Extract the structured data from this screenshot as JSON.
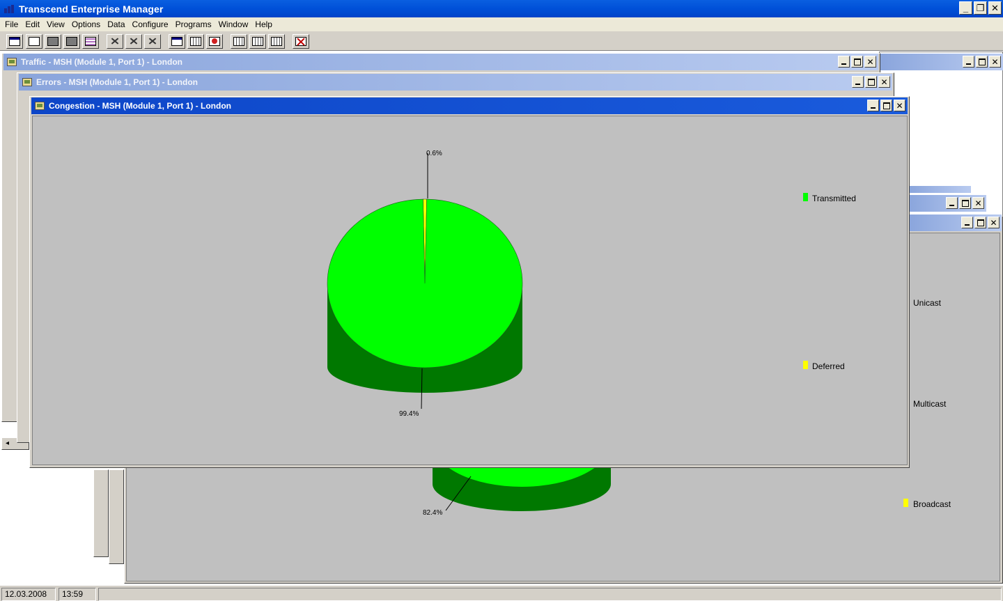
{
  "app": {
    "title": "Transcend Enterprise Manager",
    "controls": {
      "minimize": "_",
      "restore": "❐",
      "close": "✕"
    }
  },
  "menu": [
    "File",
    "Edit",
    "View",
    "Options",
    "Data",
    "Configure",
    "Programs",
    "Window",
    "Help"
  ],
  "toolbar": {
    "buttons": [
      "window-icon",
      "copy-icon",
      "export-icon",
      "add-node-icon",
      "print-icon",
      "tools-icon",
      "tools-x-icon",
      "tools-check-icon",
      "link-icon",
      "grid-icon",
      "alarm-icon",
      "table-icon",
      "table2-icon",
      "keyboard-icon",
      "stop-icon"
    ]
  },
  "windows": {
    "traffic": {
      "title": "Traffic - MSH (Module 1, Port 1) - London"
    },
    "errors": {
      "title": "Errors - MSH (Module 1, Port 1) - London"
    },
    "congestion": {
      "title": "Congestion - MSH (Module 1, Port 1) - London"
    }
  },
  "chart_data": [
    {
      "type": "pie",
      "window": "Congestion - MSH (Module 1, Port 1) - London",
      "categories": [
        "Transmitted",
        "Deferred"
      ],
      "values": [
        99.4,
        0.6
      ],
      "data_labels": [
        "99.4%",
        "0.6%"
      ],
      "colors": [
        "#00ff00",
        "#ffff00"
      ],
      "legend_position": "right",
      "style": "3d"
    },
    {
      "type": "pie",
      "window": "background",
      "categories": [
        "Unicast",
        "Multicast",
        "Broadcast"
      ],
      "visible_data_labels": [
        "82.4%"
      ],
      "colors": [
        "#00ff00",
        "#00ff00",
        "#ffff00"
      ],
      "legend_position": "right",
      "style": "3d"
    }
  ],
  "legend": {
    "congestion": [
      {
        "label": "Transmitted",
        "color": "#00ff00"
      },
      {
        "label": "Deferred",
        "color": "#ffff00"
      }
    ],
    "background": [
      {
        "label": "Unicast"
      },
      {
        "label": "Multicast"
      },
      {
        "label": "Broadcast",
        "color": "#ffff00"
      }
    ]
  },
  "labels": {
    "congestion_top": "0.6%",
    "congestion_bottom": "99.4%",
    "background_bottom": "82.4%"
  },
  "status": {
    "date": "12.03.2008",
    "time": "13:59"
  }
}
